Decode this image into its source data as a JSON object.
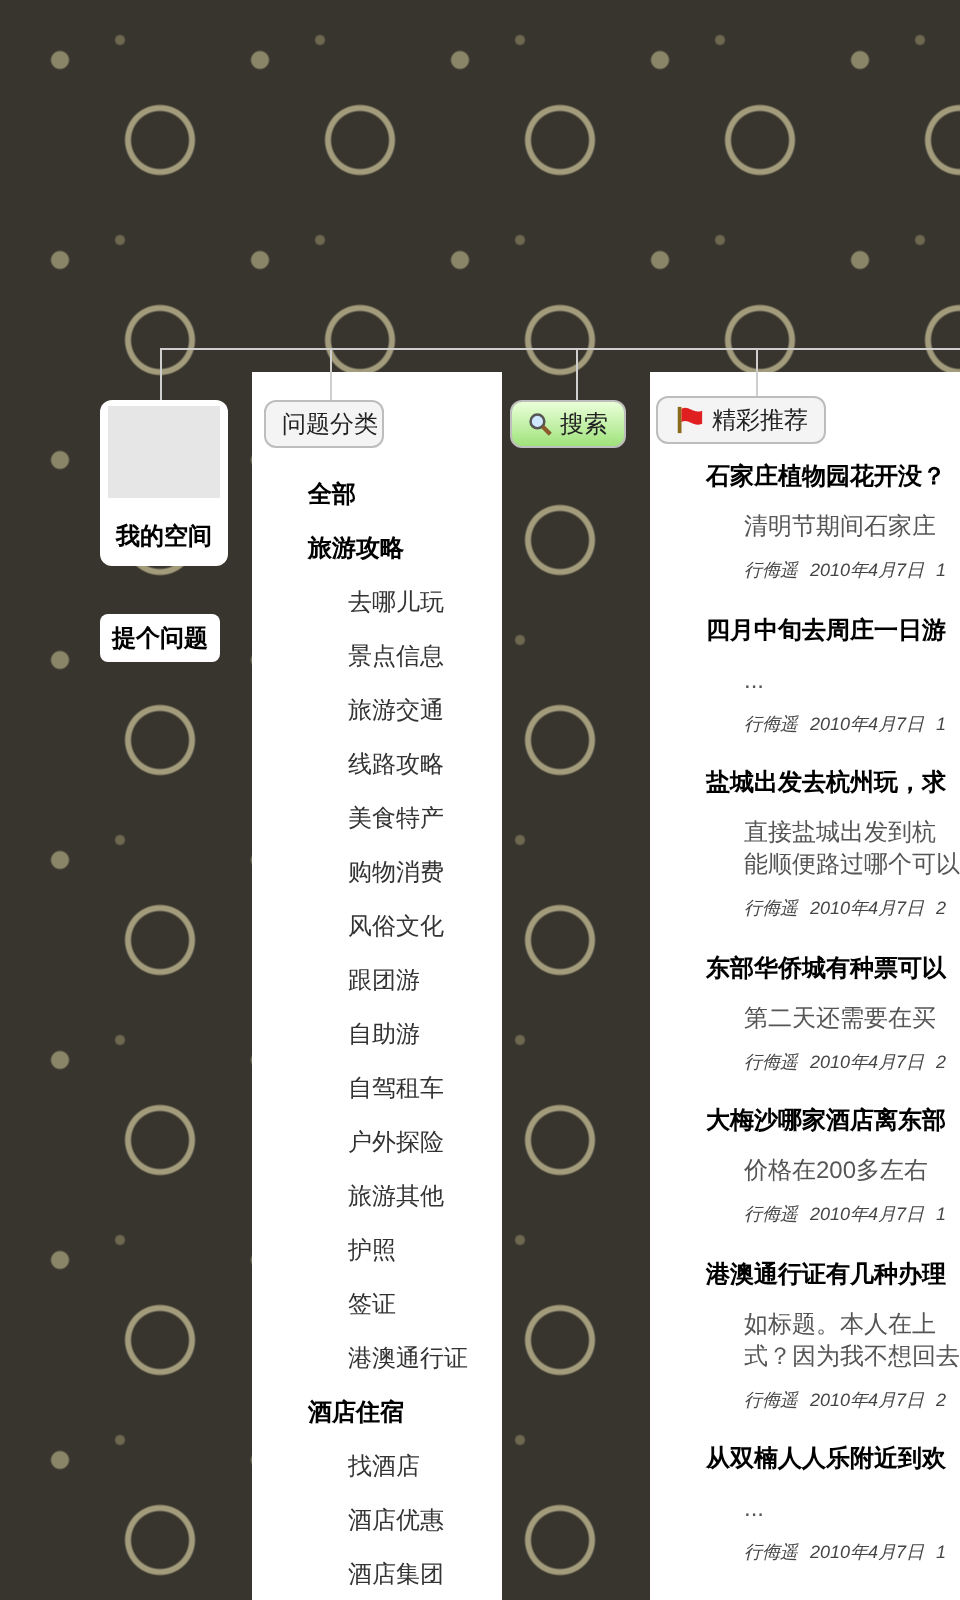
{
  "my_space": {
    "label": "我的空间"
  },
  "ask_button": {
    "label": "提个问题"
  },
  "categories": {
    "tag": "问题分类",
    "groups": [
      {
        "label": "全部"
      },
      {
        "label": "旅游攻略",
        "children": [
          {
            "label": "去哪儿玩"
          },
          {
            "label": "景点信息"
          },
          {
            "label": "旅游交通"
          },
          {
            "label": "线路攻略"
          },
          {
            "label": "美食特产"
          },
          {
            "label": "购物消费"
          },
          {
            "label": "风俗文化"
          },
          {
            "label": "跟团游"
          },
          {
            "label": "自助游"
          },
          {
            "label": "自驾租车"
          },
          {
            "label": "户外探险"
          },
          {
            "label": "旅游其他"
          },
          {
            "label": "护照"
          },
          {
            "label": "签证"
          },
          {
            "label": "港澳通行证"
          }
        ]
      },
      {
        "label": "酒店住宿",
        "children": [
          {
            "label": "找酒店"
          },
          {
            "label": "酒店优惠"
          },
          {
            "label": "酒店集团"
          }
        ]
      }
    ]
  },
  "search": {
    "label": "搜索"
  },
  "featured": {
    "tag": "精彩推荐",
    "questions": [
      {
        "title": "石家庄植物园花开没？",
        "body": [
          "清明节期间石家庄"
        ],
        "author": "行侮遥",
        "date": "2010年4月7日",
        "count": "1"
      },
      {
        "title": "四月中旬去周庄一日游",
        "body": [
          "..."
        ],
        "author": "行侮遥",
        "date": "2010年4月7日",
        "count": "1"
      },
      {
        "title": "盐城出发去杭州玩，求",
        "body": [
          "直接盐城出发到杭",
          "能顺便路过哪个可以"
        ],
        "author": "行侮遥",
        "date": "2010年4月7日",
        "count": "2"
      },
      {
        "title": "东部华侨城有种票可以",
        "body": [
          "第二天还需要在买"
        ],
        "author": "行侮遥",
        "date": "2010年4月7日",
        "count": "2"
      },
      {
        "title": "大梅沙哪家酒店离东部",
        "body": [
          "价格在200多左右"
        ],
        "author": "行侮遥",
        "date": "2010年4月7日",
        "count": "1"
      },
      {
        "title": "港澳通行证有几种办理",
        "body": [
          "如标题。本人在上",
          "式？因为我不想回去"
        ],
        "author": "行侮遥",
        "date": "2010年4月7日",
        "count": "2"
      },
      {
        "title": "从双楠人人乐附近到欢",
        "body": [
          "..."
        ],
        "author": "行侮遥",
        "date": "2010年4月7日",
        "count": "1"
      }
    ]
  }
}
